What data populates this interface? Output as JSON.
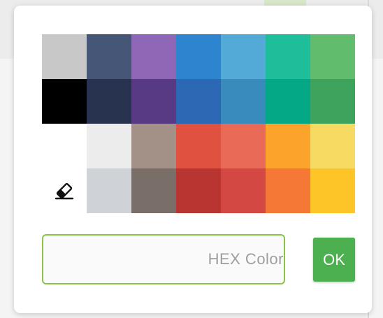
{
  "palette": {
    "rows": [
      [
        "#c8c8c8",
        "#465677",
        "#8e67b6",
        "#2d84cf",
        "#53aad6",
        "#1fbe9b",
        "#62bc6d"
      ],
      [
        "#000000",
        "#283350",
        "#583a84",
        "#2c68b3",
        "#3a8bbd",
        "#04a887",
        "#3ea45d"
      ],
      [
        "",
        "#ececec",
        "#a39087",
        "#e1513f",
        "#ea6a58",
        "#fca32b",
        "#f6da61"
      ],
      [
        "eraser",
        "#cfd3d8",
        "#7a6e68",
        "#b93531",
        "#d34842",
        "#f67837",
        "#fdc528"
      ]
    ]
  },
  "icons": {
    "eraser": "eraser-icon"
  },
  "hex_input": {
    "placeholder": "HEX Color",
    "value": ""
  },
  "ok_button": {
    "label": "OK",
    "color": "#4caf50"
  },
  "colors": {
    "input_border": "#8bc34a"
  }
}
